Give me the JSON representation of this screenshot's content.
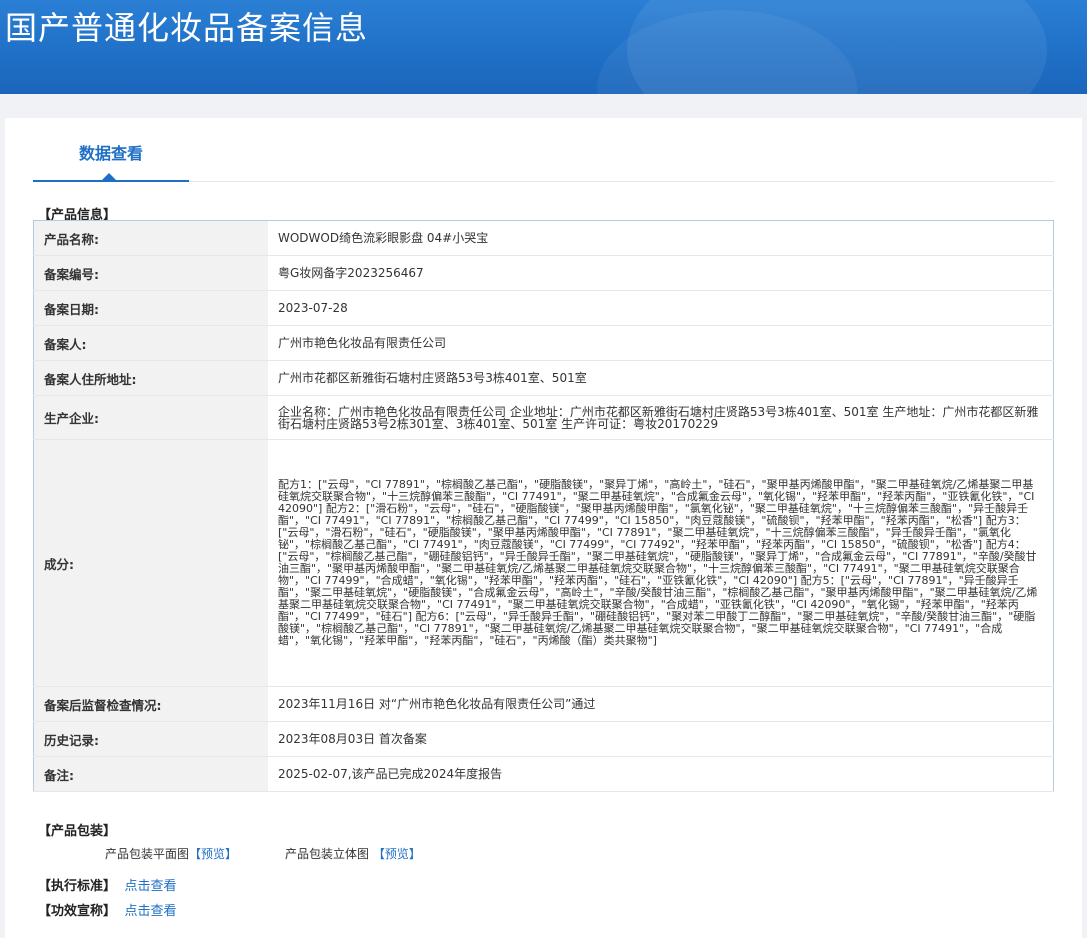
{
  "header": {
    "title": "国产普通化妆品备案信息"
  },
  "tab": {
    "label": "数据查看"
  },
  "product_section": {
    "title": "【产品信息】"
  },
  "rows": {
    "name": {
      "label": "产品名称:",
      "value": "WODWOD绮色流彩眼影盘 04#小哭宝"
    },
    "code": {
      "label": "备案编号:",
      "value": "粤G妆网备字2023256467"
    },
    "date": {
      "label": "备案日期:",
      "value": "2023-07-28"
    },
    "filer": {
      "label": "备案人:",
      "value": "广州市艳色化妆品有限责任公司"
    },
    "addr": {
      "label": "备案人住所地址:",
      "value": "广州市花都区新雅街石塘村庄贤路53号3栋401室、501室"
    },
    "mfr": {
      "label": "生产企业:",
      "value": "企业名称：广州市艳色化妆品有限责任公司 企业地址：广州市花都区新雅街石塘村庄贤路53号3栋401室、501室 生产地址：广州市花都区新雅街石塘村庄贤路53号2栋301室、3栋401室、501室 生产许可证：粤妆20170229"
    },
    "ingredients": {
      "label": "成分:",
      "value": "配方1：[\"云母\"，\"CI 77891\"，\"棕榈酸乙基己酯\"，\"硬脂酸镁\"，\"聚异丁烯\"，\"高岭土\"，\"硅石\"，\"聚甲基丙烯酸甲酯\"，\"聚二甲基硅氧烷/乙烯基聚二甲基硅氧烷交联聚合物\"，\"十三烷醇偏苯三酸酯\"，\"CI 77491\"，\"聚二甲基硅氧烷\"，\"合成氟金云母\"，\"氧化锡\"，\"羟苯甲酯\"，\"羟苯丙酯\"，\"亚铁氰化铁\"，\"CI 42090\"] 配方2：[\"滑石粉\"，\"云母\"，\"硅石\"，\"硬脂酸镁\"，\"聚甲基丙烯酸甲酯\"，\"氯氧化铋\"，\"聚二甲基硅氧烷\"，\"十三烷醇偏苯三酸酯\"，\"异壬酸异壬酯\"，\"CI 77491\"，\"CI 77891\"，\"棕榈酸乙基己酯\"，\"CI 77499\"，\"CI 15850\"，\"肉豆蔻酸镁\"，\"硫酸钡\"，\"羟苯甲酯\"，\"羟苯丙酯\"，\"松香\"] 配方3：[\"云母\"，\"滑石粉\"，\"硅石\"，\"硬脂酸镁\"，\"聚甲基丙烯酸甲酯\"，\"CI 77891\"，\"聚二甲基硅氧烷\"，\"十三烷醇偏苯三酸酯\"，\"异壬酸异壬酯\"，\"氯氧化铋\"，\"棕榈酸乙基己酯\"，\"CI 77491\"，\"肉豆蔻酸镁\"，\"CI 77499\"，\"CI 77492\"，\"羟苯甲酯\"，\"羟苯丙酯\"，\"CI 15850\"，\"硫酸钡\"，\"松香\"] 配方4：[\"云母\"，\"棕榈酸乙基己酯\"，\"硼硅酸铝钙\"，\"异壬酸异壬酯\"，\"聚二甲基硅氧烷\"，\"硬脂酸镁\"，\"聚异丁烯\"，\"合成氟金云母\"，\"CI 77891\"，\"辛酸/癸酸甘油三酯\"，\"聚甲基丙烯酸甲酯\"，\"聚二甲基硅氧烷/乙烯基聚二甲基硅氧烷交联聚合物\"，\"十三烷醇偏苯三酸酯\"，\"CI 77491\"，\"聚二甲基硅氧烷交联聚合物\"，\"CI 77499\"，\"合成蜡\"，\"氧化锡\"，\"羟苯甲酯\"，\"羟苯丙酯\"，\"硅石\"，\"亚铁氰化铁\"，\"CI 42090\"] 配方5：[\"云母\"，\"CI 77891\"，\"异壬酸异壬酯\"，\"聚二甲基硅氧烷\"，\"硬脂酸镁\"，\"合成氟金云母\"，\"高岭土\"，\"辛酸/癸酸甘油三酯\"，\"棕榈酸乙基己酯\"，\"聚甲基丙烯酸甲酯\"，\"聚二甲基硅氧烷/乙烯基聚二甲基硅氧烷交联聚合物\"，\"CI 77491\"，\"聚二甲基硅氧烷交联聚合物\"，\"合成蜡\"，\"亚铁氰化铁\"，\"CI 42090\"，\"氧化锡\"，\"羟苯甲酯\"，\"羟苯丙酯\"，\"CI 77499\"，\"硅石\"] 配方6：[\"云母\"，\"异壬酸异壬酯\"，\"硼硅酸铝钙\"，\"聚对苯二甲酸丁二醇酯\"，\"聚二甲基硅氧烷\"，\"辛酸/癸酸甘油三酯\"，\"硬脂酸镁\"，\"棕榈酸乙基己酯\"，\"CI 77891\"，\"聚二甲基硅氧烷/乙烯基聚二甲基硅氧烷交联聚合物\"，\"聚二甲基硅氧烷交联聚合物\"，\"CI 77491\"，\"合成蜡\"，\"氧化锡\"，\"羟苯甲酯\"，\"羟苯丙酯\"，\"硅石\"，\"丙烯酸（酯）类共聚物\"]"
    },
    "inspect": {
      "label": "备案后监督检查情况:",
      "value": "2023年11月16日 对“广州市艳色化妆品有限责任公司”通过"
    },
    "history": {
      "label": "历史记录:",
      "value": "2023年08月03日 首次备案"
    },
    "remark": {
      "label": "备注:",
      "value": "2025-02-07,该产品已完成2024年度报告"
    }
  },
  "packaging": {
    "title": "【产品包装】",
    "flat_label": "产品包装平面图",
    "flat_link": "【预览】",
    "stereo_label": "产品包装立体图",
    "stereo_link": "【预览】"
  },
  "standard": {
    "title": "【执行标准】",
    "link": "点击查看"
  },
  "efficacy": {
    "title": "【功效宣称】",
    "link": "点击查看"
  }
}
